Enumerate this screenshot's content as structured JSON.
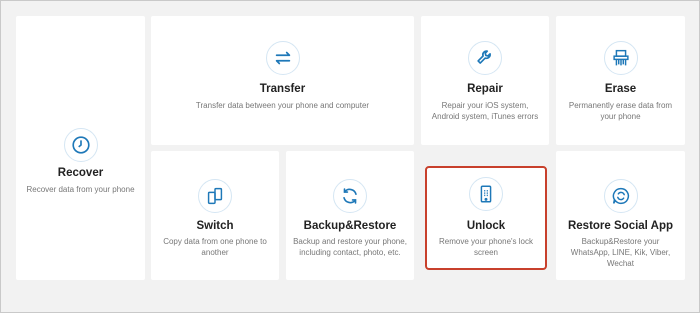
{
  "cards": {
    "recover": {
      "title": "Recover",
      "desc": "Recover data from your phone"
    },
    "transfer": {
      "title": "Transfer",
      "desc": "Transfer data between your phone and computer"
    },
    "repair": {
      "title": "Repair",
      "desc": "Repair your iOS system, Android system, iTunes errors"
    },
    "erase": {
      "title": "Erase",
      "desc": "Permanently erase data from your phone"
    },
    "switch": {
      "title": "Switch",
      "desc": "Copy data from one phone to another"
    },
    "backup": {
      "title": "Backup&Restore",
      "desc": "Backup and restore your phone, including contact, photo, etc."
    },
    "unlock": {
      "title": "Unlock",
      "desc": "Remove your phone's lock screen"
    },
    "social": {
      "title": "Restore Social App",
      "desc": "Backup&Restore your WhatsApp, LINE, Kik, Viber, Wechat"
    }
  },
  "accent": "#1e78b8",
  "highlight": "#c8402c"
}
